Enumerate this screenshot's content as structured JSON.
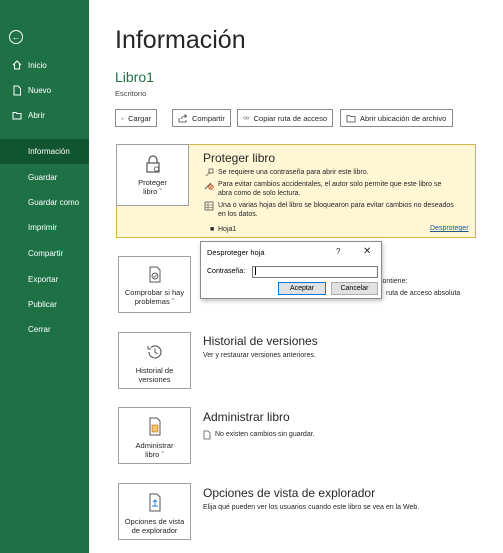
{
  "sidebar": {
    "items": [
      {
        "label": "Inicio",
        "icon": "home-icon"
      },
      {
        "label": "Nuevo",
        "icon": "new-document-icon"
      },
      {
        "label": "Abrir",
        "icon": "folder-open-icon"
      }
    ],
    "selected": "Información",
    "text_items": [
      "Guardar",
      "Guardar como",
      "Imprimir",
      "Compartir",
      "Exportar",
      "Publicar",
      "Cerrar"
    ],
    "colors": {
      "background": "#1e7145",
      "selected": "#10552f"
    }
  },
  "main": {
    "title": "Información",
    "book_name": "Libro1",
    "location": "Escritorio",
    "buttons": [
      {
        "label": "Cargar",
        "icon": "upload-icon"
      },
      {
        "label": "Compartir",
        "icon": "share-icon"
      },
      {
        "label": "Copiar ruta de acceso",
        "icon": "link-icon"
      },
      {
        "label": "Abrir ubicación de archivo",
        "icon": "folder-icon"
      }
    ]
  },
  "protect": {
    "tile_label_1": "Proteger",
    "tile_label_2": "libro",
    "heading": "Proteger libro",
    "line1": "Se requiere una contraseña para abrir este libro.",
    "line2a": "Para evitar cambios accidentales, el autor solo permite que este libro se",
    "line2b": "abra como de solo lectura.",
    "line3a": "Una o varias hojas del libro se bloquearon para evitar cambios no deseados",
    "line3b": "en los datos.",
    "sheet": "Hoja1",
    "unprotect_link": "Desproteger",
    "colors": {
      "background": "#fff6d5",
      "border": "#d4b54a"
    }
  },
  "inspect": {
    "tile_label_1": "Comprobar si hay",
    "tile_label_2": "problemas",
    "partial_text_1": "contiene:",
    "partial_text_2": "ruta de acceso absoluta"
  },
  "versions": {
    "tile_label_1": "Historial de",
    "tile_label_2": "versiones",
    "heading": "Historial de versiones",
    "text": "Ver y restaurar versiones anteriores."
  },
  "manage": {
    "tile_label_1": "Administrar",
    "tile_label_2": "libro",
    "heading": "Administrar libro",
    "text": "No existen cambios sin guardar."
  },
  "browser": {
    "tile_label_1": "Opciones de vista",
    "tile_label_2": "de explorador",
    "heading": "Opciones de vista de explorador",
    "text": "Elija qué pueden ver los usuarios cuando este libro se vea en la Web."
  },
  "dialog": {
    "title": "Desproteger hoja",
    "help": "?",
    "close": "✕",
    "password_label": "Contraseña:",
    "password_value": "",
    "ok_label": "Aceptar",
    "cancel_label": "Cancelar"
  }
}
